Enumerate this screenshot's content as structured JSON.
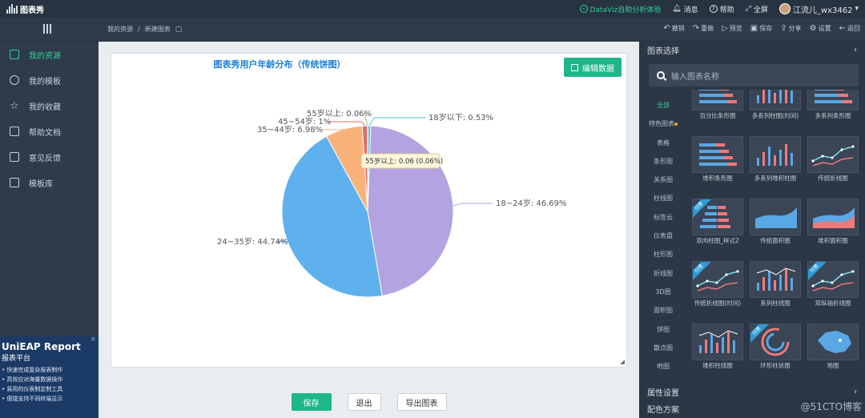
{
  "topbar": {
    "logo_text": "图表秀",
    "dataviz": "DataViz自助分析体验",
    "messages": "消息",
    "help": "帮助",
    "fullscreen": "全屏",
    "username": "江流儿_wx3462"
  },
  "subbar": {
    "breadcrumb_root": "我的资源",
    "breadcrumb_sep": "/",
    "breadcrumb_current": "新建图表",
    "tools": [
      "撤销",
      "重做",
      "预览",
      "保存",
      "分享",
      "设置",
      "返回"
    ]
  },
  "sidebar": {
    "items": [
      {
        "label": "我的资源",
        "active": true
      },
      {
        "label": "我的模板"
      },
      {
        "label": "我的收藏"
      },
      {
        "label": "帮助文档"
      },
      {
        "label": "意见反馈"
      },
      {
        "label": "模板库"
      }
    ],
    "ad": {
      "title": "UniEAP Report",
      "subtitle": "报表平台",
      "lines": [
        "快速完成复杂报表制作",
        "高效应对海量数据操作",
        "易用的仪表制定制工具",
        "便捷支持不同终端显示"
      ],
      "close": "×"
    }
  },
  "main": {
    "edit_button": "编辑数据",
    "save": "保存",
    "exit": "退出",
    "export": "导出图表",
    "tooltip": "55岁以上: 0.06 (0.06%)"
  },
  "chart_data": {
    "type": "pie",
    "title": "图表秀用户年龄分布（传统饼图）",
    "slices": [
      {
        "label": "18~24岁: 46.69%",
        "name": "18~24岁",
        "value": 46.69,
        "color": "#b3a3e0"
      },
      {
        "label": "24~35岁: 44.74%",
        "name": "24~35岁",
        "value": 44.74,
        "color": "#5eb1ec"
      },
      {
        "label": "35~44岁: 6.98%",
        "name": "35~44岁",
        "value": 6.98,
        "color": "#f9b27a"
      },
      {
        "label": "45~54岁: 1%",
        "name": "45~54岁",
        "value": 1,
        "color": "#e06f6b"
      },
      {
        "label": "55岁以上: 0.06%",
        "name": "55岁以上",
        "value": 0.06,
        "color": "#9bcd8a"
      },
      {
        "label": "18岁以下: 0.53%",
        "name": "18岁以下",
        "value": 0.53,
        "color": "#49c3d6"
      }
    ]
  },
  "right_panel": {
    "title": "图表选择",
    "search_placeholder": "输入图表名称",
    "categories": [
      "全部",
      "特色图表",
      "表格",
      "条形图",
      "关系图",
      "柱线图",
      "标签云",
      "仪表盘",
      "柱形图",
      "折线图",
      "3D图",
      "面积图",
      "饼图",
      "散点图",
      "地图"
    ],
    "tiles": [
      {
        "label": "百分比条形图"
      },
      {
        "label": "多系列柱图(时间)"
      },
      {
        "label": "多系列条形图"
      },
      {
        "label": "堆积条形图"
      },
      {
        "label": "多系列堆积柱图"
      },
      {
        "label": "传统折线图"
      },
      {
        "label": "双向柱图_样式2",
        "badge": "付费"
      },
      {
        "label": "传统面积图"
      },
      {
        "label": "堆积面积图"
      },
      {
        "label": "传统折线图(时间)",
        "badge": "付费"
      },
      {
        "label": "系列柱线图"
      },
      {
        "label": "双纵轴折线图",
        "badge": "付费"
      },
      {
        "label": "堆积柱线图"
      },
      {
        "label": "环形柱状图",
        "badge": "付费"
      },
      {
        "label": "地图"
      }
    ],
    "attr_settings": "属性设置",
    "color_scheme": "配色方案",
    "watermark": "@51CTO博客"
  },
  "colors": {
    "accent": "#2ed39b",
    "primary": "#1fb78a",
    "title": "#1b7ed6"
  }
}
